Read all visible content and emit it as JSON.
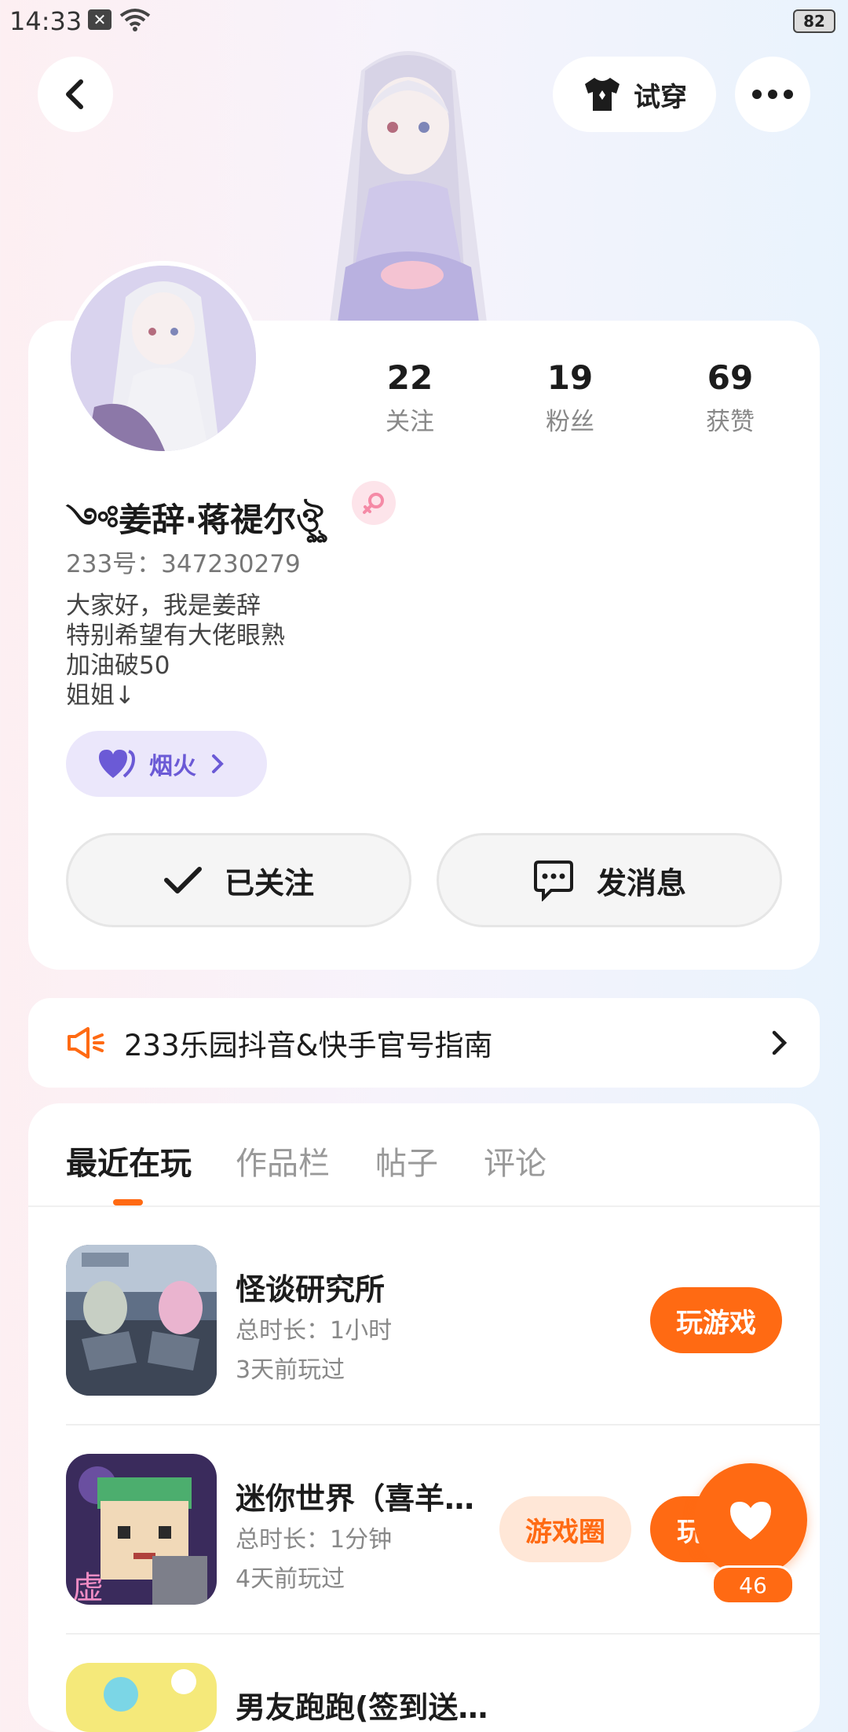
{
  "status_bar": {
    "time": "14:33",
    "battery": "82"
  },
  "header": {
    "try_on_label": "试穿"
  },
  "stats": [
    {
      "count": "22",
      "label": "关注"
    },
    {
      "count": "19",
      "label": "粉丝"
    },
    {
      "count": "69",
      "label": "获赞"
    }
  ],
  "profile": {
    "username": "༺姜辞·蒋禔尔ঔৣ",
    "uid": "233号：347230279",
    "bio": [
      "大家好，我是姜辞",
      "特别希望有大佬眼熟",
      "加油破50",
      "姐姐↓"
    ],
    "firework_label": "烟火"
  },
  "actions": {
    "followed_label": "已关注",
    "message_label": "发消息"
  },
  "notice": {
    "text": "233乐园抖音&快手官号指南"
  },
  "tabs": [
    {
      "label": "最近在玩"
    },
    {
      "label": "作品栏"
    },
    {
      "label": "帖子"
    },
    {
      "label": "评论"
    }
  ],
  "games": [
    {
      "title": "怪谈研究所",
      "duration": "总时长：1小时",
      "last_played": "3天前玩过",
      "play_label": "玩游戏"
    },
    {
      "title": "迷你世界（喜羊…",
      "duration": "总时长：1分钟",
      "last_played": "4天前玩过",
      "circle_label": "游戏圈",
      "play_label": "玩"
    },
    {
      "title": "男友跑跑(签到送…"
    }
  ],
  "like": {
    "count": "46"
  },
  "colors": {
    "accent": "#ff6a13",
    "chip": "#ebe7fb",
    "chip_text": "#6b5ad6",
    "gender": "#f58aa6"
  }
}
